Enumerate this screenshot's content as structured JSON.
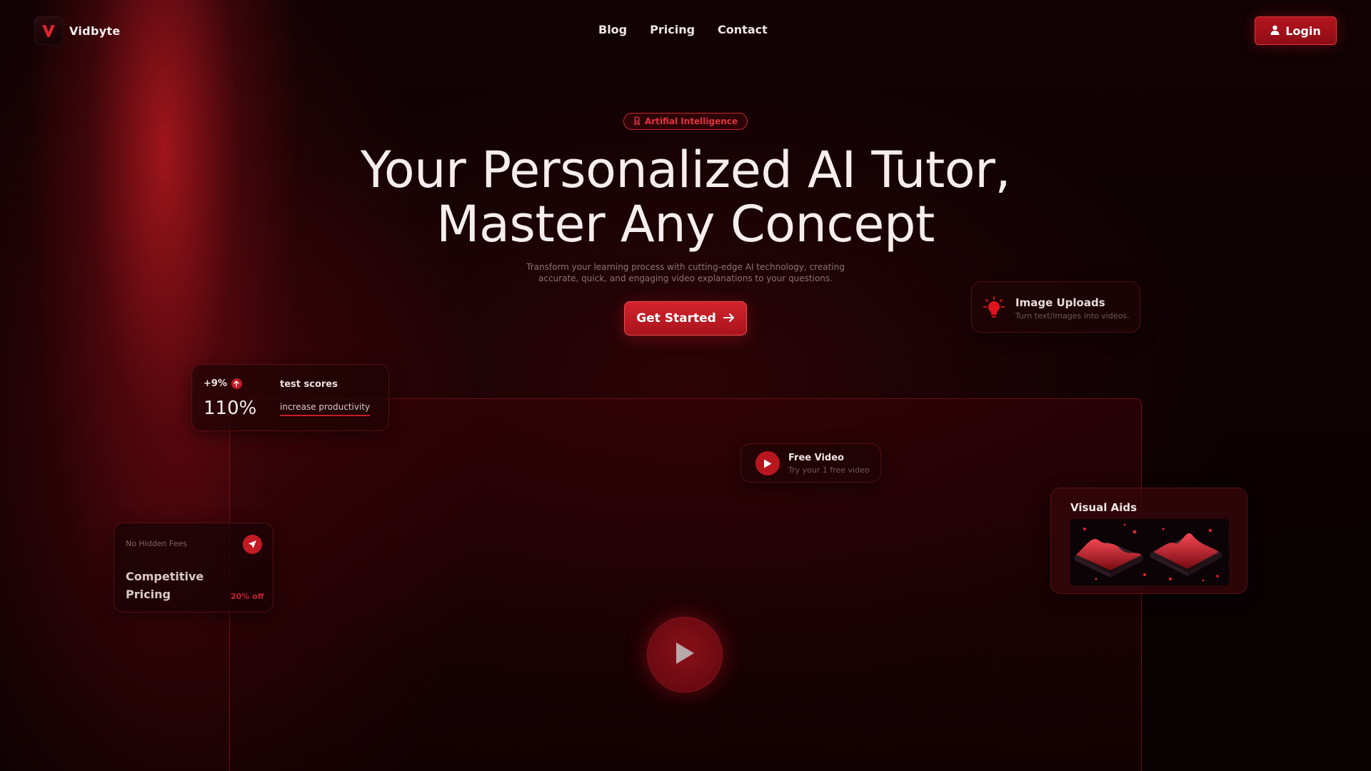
{
  "brand": {
    "name": "Vidbyte",
    "logo_letter": "V",
    "accent": "#c41a24"
  },
  "nav": {
    "links": [
      "Blog",
      "Pricing",
      "Contact"
    ],
    "login_label": "Login"
  },
  "hero": {
    "badge": "Artifial Intelligence",
    "title_line1": "Your Personalized AI Tutor,",
    "title_line2": "Master Any Concept",
    "subtitle_line1": "Transform your learning process with cutting-edge AI technology, creating",
    "subtitle_line2": "accurate, quick, and engaging video explanations to your questions.",
    "cta_label": "Get Started"
  },
  "cards": {
    "stats": {
      "delta": "+9%",
      "big_value": "110%",
      "label": "test scores",
      "link": "increase productivity"
    },
    "upload": {
      "title": "Image Uploads",
      "subtitle": "Turn text/images into videos."
    },
    "free_video": {
      "title": "Free Video",
      "subtitle": "Try your 1 free video"
    },
    "visual_aids": {
      "title": "Visual Aids"
    },
    "pricing": {
      "small": "No Hidden Fees",
      "title": "Competitive Pricing",
      "discount": "20% off"
    }
  },
  "icons": {
    "logo": "v-logo-icon",
    "login": "user-icon",
    "badge": "award-icon",
    "cta": "arrow-right-icon",
    "up": "arrow-up-icon",
    "upload": "lightbulb-icon",
    "free_video": "play-icon",
    "pricing": "send-icon",
    "video": "play-icon"
  }
}
